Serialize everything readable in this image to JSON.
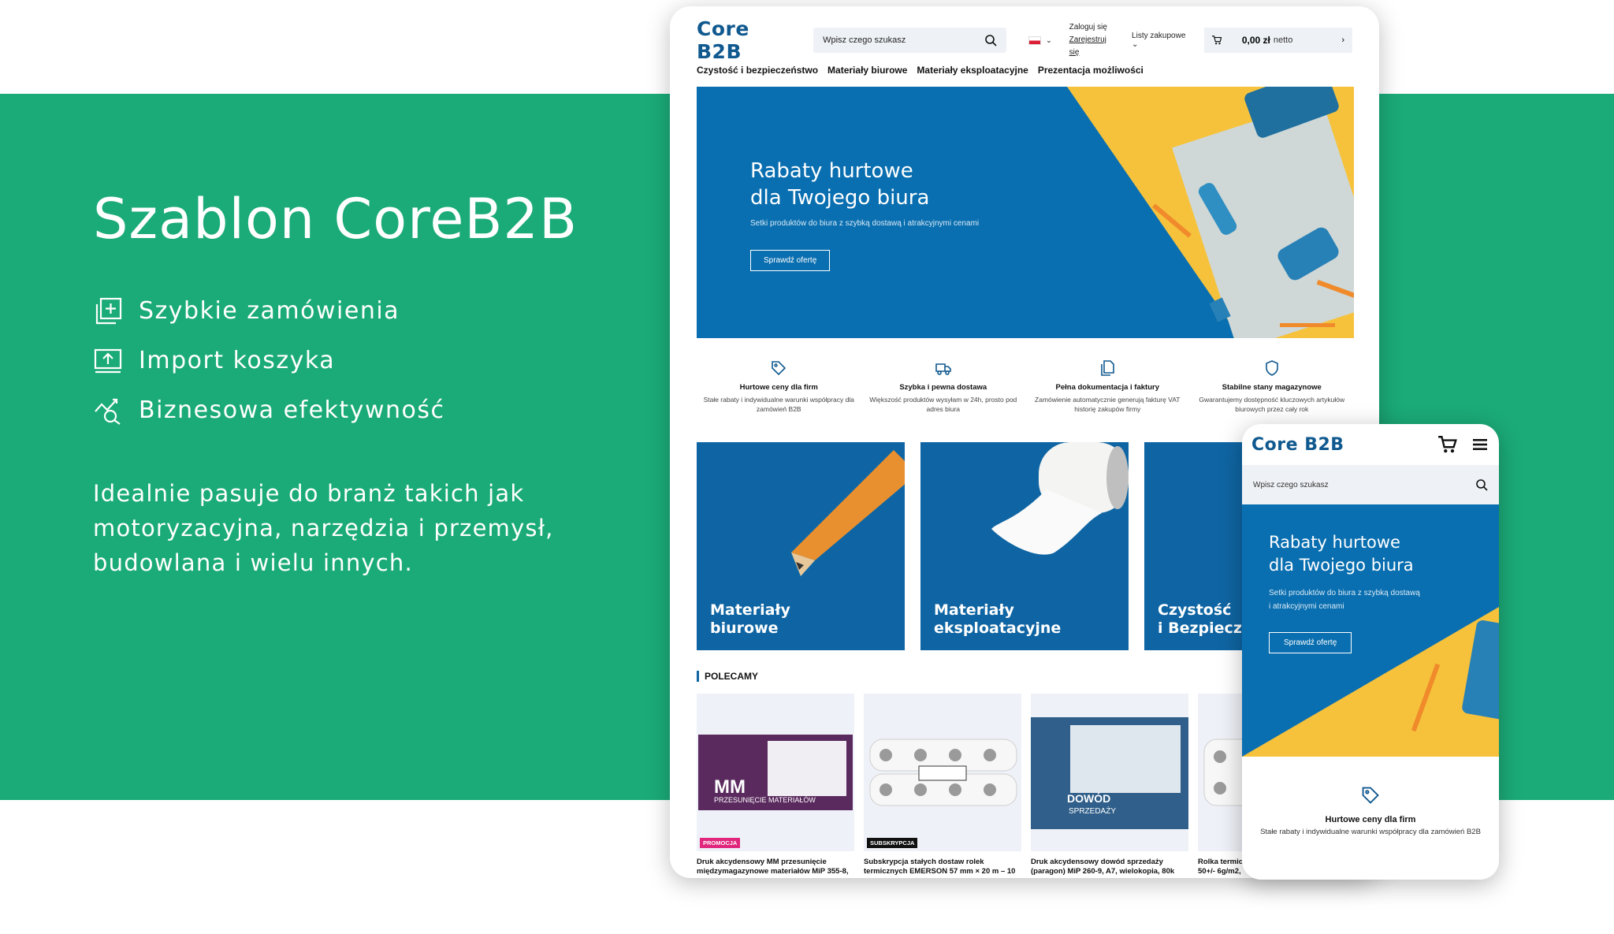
{
  "colors": {
    "green": "#1bab78",
    "brand_blue": "#10598f",
    "hero_blue": "#0a6fb0",
    "yellow": "#f6c23c",
    "promo_pink": "#e0267d"
  },
  "left": {
    "title": "Szablon CoreB2B",
    "features": [
      {
        "icon": "add-square-icon",
        "label": "Szybkie zamówienia"
      },
      {
        "icon": "upload-screen-icon",
        "label": "Import koszyka"
      },
      {
        "icon": "analytics-search-icon",
        "label": "Biznesowa efektywność"
      }
    ],
    "description": [
      "Idealnie pasuje do branż takich jak",
      "motoryzacyjna, narzędzia i przemysł,",
      "budowlana i wielu innych."
    ]
  },
  "desktop": {
    "logo": "Core B2B",
    "search_placeholder": "Wpisz czego szukasz",
    "login": "Zaloguj się",
    "register": "Zarejestruj się",
    "lists": "Listy zakupowe",
    "cart_amount": "0,00 zł",
    "cart_netto": "netto",
    "nav": [
      "Czystość i bezpieczeństwo",
      "Materiały biurowe",
      "Materiały eksploatacyjne",
      "Prezentacja możliwości"
    ],
    "hero": {
      "title_line1": "Rabaty hurtowe",
      "title_line2": "dla Twojego biura",
      "subtitle": "Setki produktów do biura z szybką dostawą i atrakcyjnymi cenami",
      "button": "Sprawdź ofertę"
    },
    "usps": [
      {
        "icon": "tag-icon",
        "title": "Hurtowe ceny dla firm",
        "desc": "Stałe rabaty i indywidualne warunki współpracy dla zamówień B2B"
      },
      {
        "icon": "truck-icon",
        "title": "Szybka i pewna dostawa",
        "desc": "Większość produktów wysyłam w 24h, prosto pod adres biura"
      },
      {
        "icon": "documents-icon",
        "title": "Pełna dokumentacja i faktury",
        "desc": "Zamówienie automatycznie generują fakturę VAT historię zakupów firmy"
      },
      {
        "icon": "shield-icon",
        "title": "Stabilne stany magazynowe",
        "desc": "Gwarantujemy dostępność kluczowych artykułów biurowych przez cały rok"
      }
    ],
    "categories": [
      {
        "line1": "Materiały",
        "line2": "biurowe"
      },
      {
        "line1": "Materiały",
        "line2": "eksploatacyjne"
      },
      {
        "line1": "Czystość",
        "line2": "i Bezpiecze"
      }
    ],
    "recommended_title": "POLECAMY",
    "products": [
      {
        "badge": "PROMOCJA",
        "name_line1": "Druk akcydensowy MM przesunięcie",
        "name_line2": "międzymagazynowe materiałów MiP 355-8,",
        "img_text1": "MM",
        "img_text2": "PRZESUNIĘCIE MATERIAŁÓW"
      },
      {
        "badge": "SUBSKRYPCJA",
        "name_line1": "Subskrypcja stałych dostaw rolek",
        "name_line2": "termicznych EMERSON 57 mm × 20 m – 10",
        "img_text1": "",
        "img_text2": ""
      },
      {
        "badge": "",
        "name_line1": "Druk akcydensowy dowód sprzedaży",
        "name_line2": "(paragon) MiP 260-9, A7, wielokopia, 80k",
        "img_text1": "DOWÓD",
        "img_text2": "SPRZEDAŻY"
      },
      {
        "badge": "",
        "name_line1": "Rolka termicz",
        "name_line2": "50+/- 6g/m2,",
        "img_text1": "",
        "img_text2": ""
      }
    ]
  },
  "mobile": {
    "logo": "Core B2B",
    "search_placeholder": "Wpisz czego szukasz",
    "hero": {
      "title_line1": "Rabaty hurtowe",
      "title_line2": "dla Twojego biura",
      "subtitle_line1": "Setki produktów do biura z szybką dostawą",
      "subtitle_line2": "i atrakcyjnymi cenami",
      "button": "Sprawdź ofertę"
    },
    "usp": {
      "icon": "tag-icon",
      "title": "Hurtowe ceny dla firm",
      "desc": "Stałe rabaty i indywidualne warunki współpracy dla zamówień B2B"
    }
  }
}
